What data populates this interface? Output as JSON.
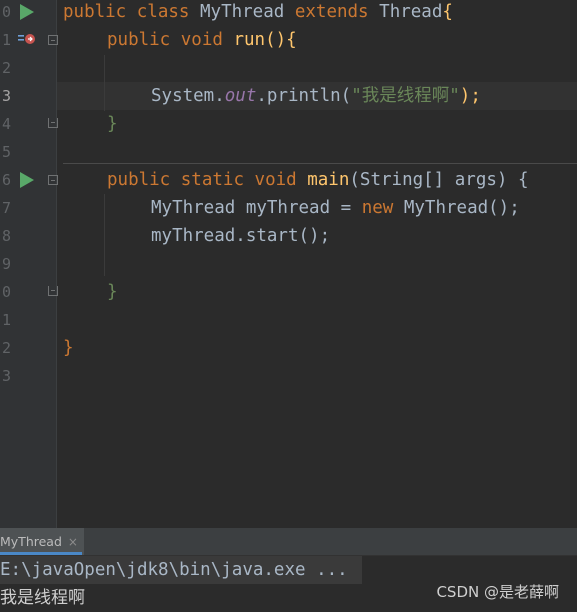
{
  "editor": {
    "line_numbers": [
      "0",
      "1",
      "2",
      "3",
      "4",
      "5",
      "6",
      "7",
      "8",
      "9",
      "0",
      "1",
      "2",
      "3"
    ],
    "current_line_index": 3,
    "lines": {
      "l0": {
        "kw1": "public",
        "kw2": "class",
        "name": "MyThread",
        "kw3": "extends",
        "parent": "Thread",
        "brace": "{"
      },
      "l1": {
        "kw1": "public",
        "kw2": "void",
        "fn": "run",
        "rest": "(){"
      },
      "l3": {
        "cls": "System.",
        "fld": "out",
        "call": ".println(",
        "str": "\"我是线程啊\"",
        "end": ");"
      },
      "l4": {
        "brace": "}"
      },
      "l6": {
        "kw1": "public",
        "kw2": "static",
        "kw3": "void",
        "fn": "main",
        "rest": "(String[] args) {"
      },
      "l7": {
        "type": "MyThread myThread = ",
        "kw": "new",
        "rest": " MyThread();"
      },
      "l8": {
        "text": "myThread.start();"
      },
      "l10": {
        "brace": "}"
      },
      "l12": {
        "brace": "}"
      }
    }
  },
  "run_panel": {
    "tab_label": "MyThread",
    "tab_close": "×",
    "command": "E:\\javaOpen\\jdk8\\bin\\java.exe ...",
    "output": "我是线程啊"
  },
  "watermark": "CSDN @是老薛啊",
  "colors": {
    "keyword": "#cc7832",
    "function": "#ffc66d",
    "string": "#6a8759",
    "field": "#9876aa",
    "run_icon": "#59a869"
  }
}
